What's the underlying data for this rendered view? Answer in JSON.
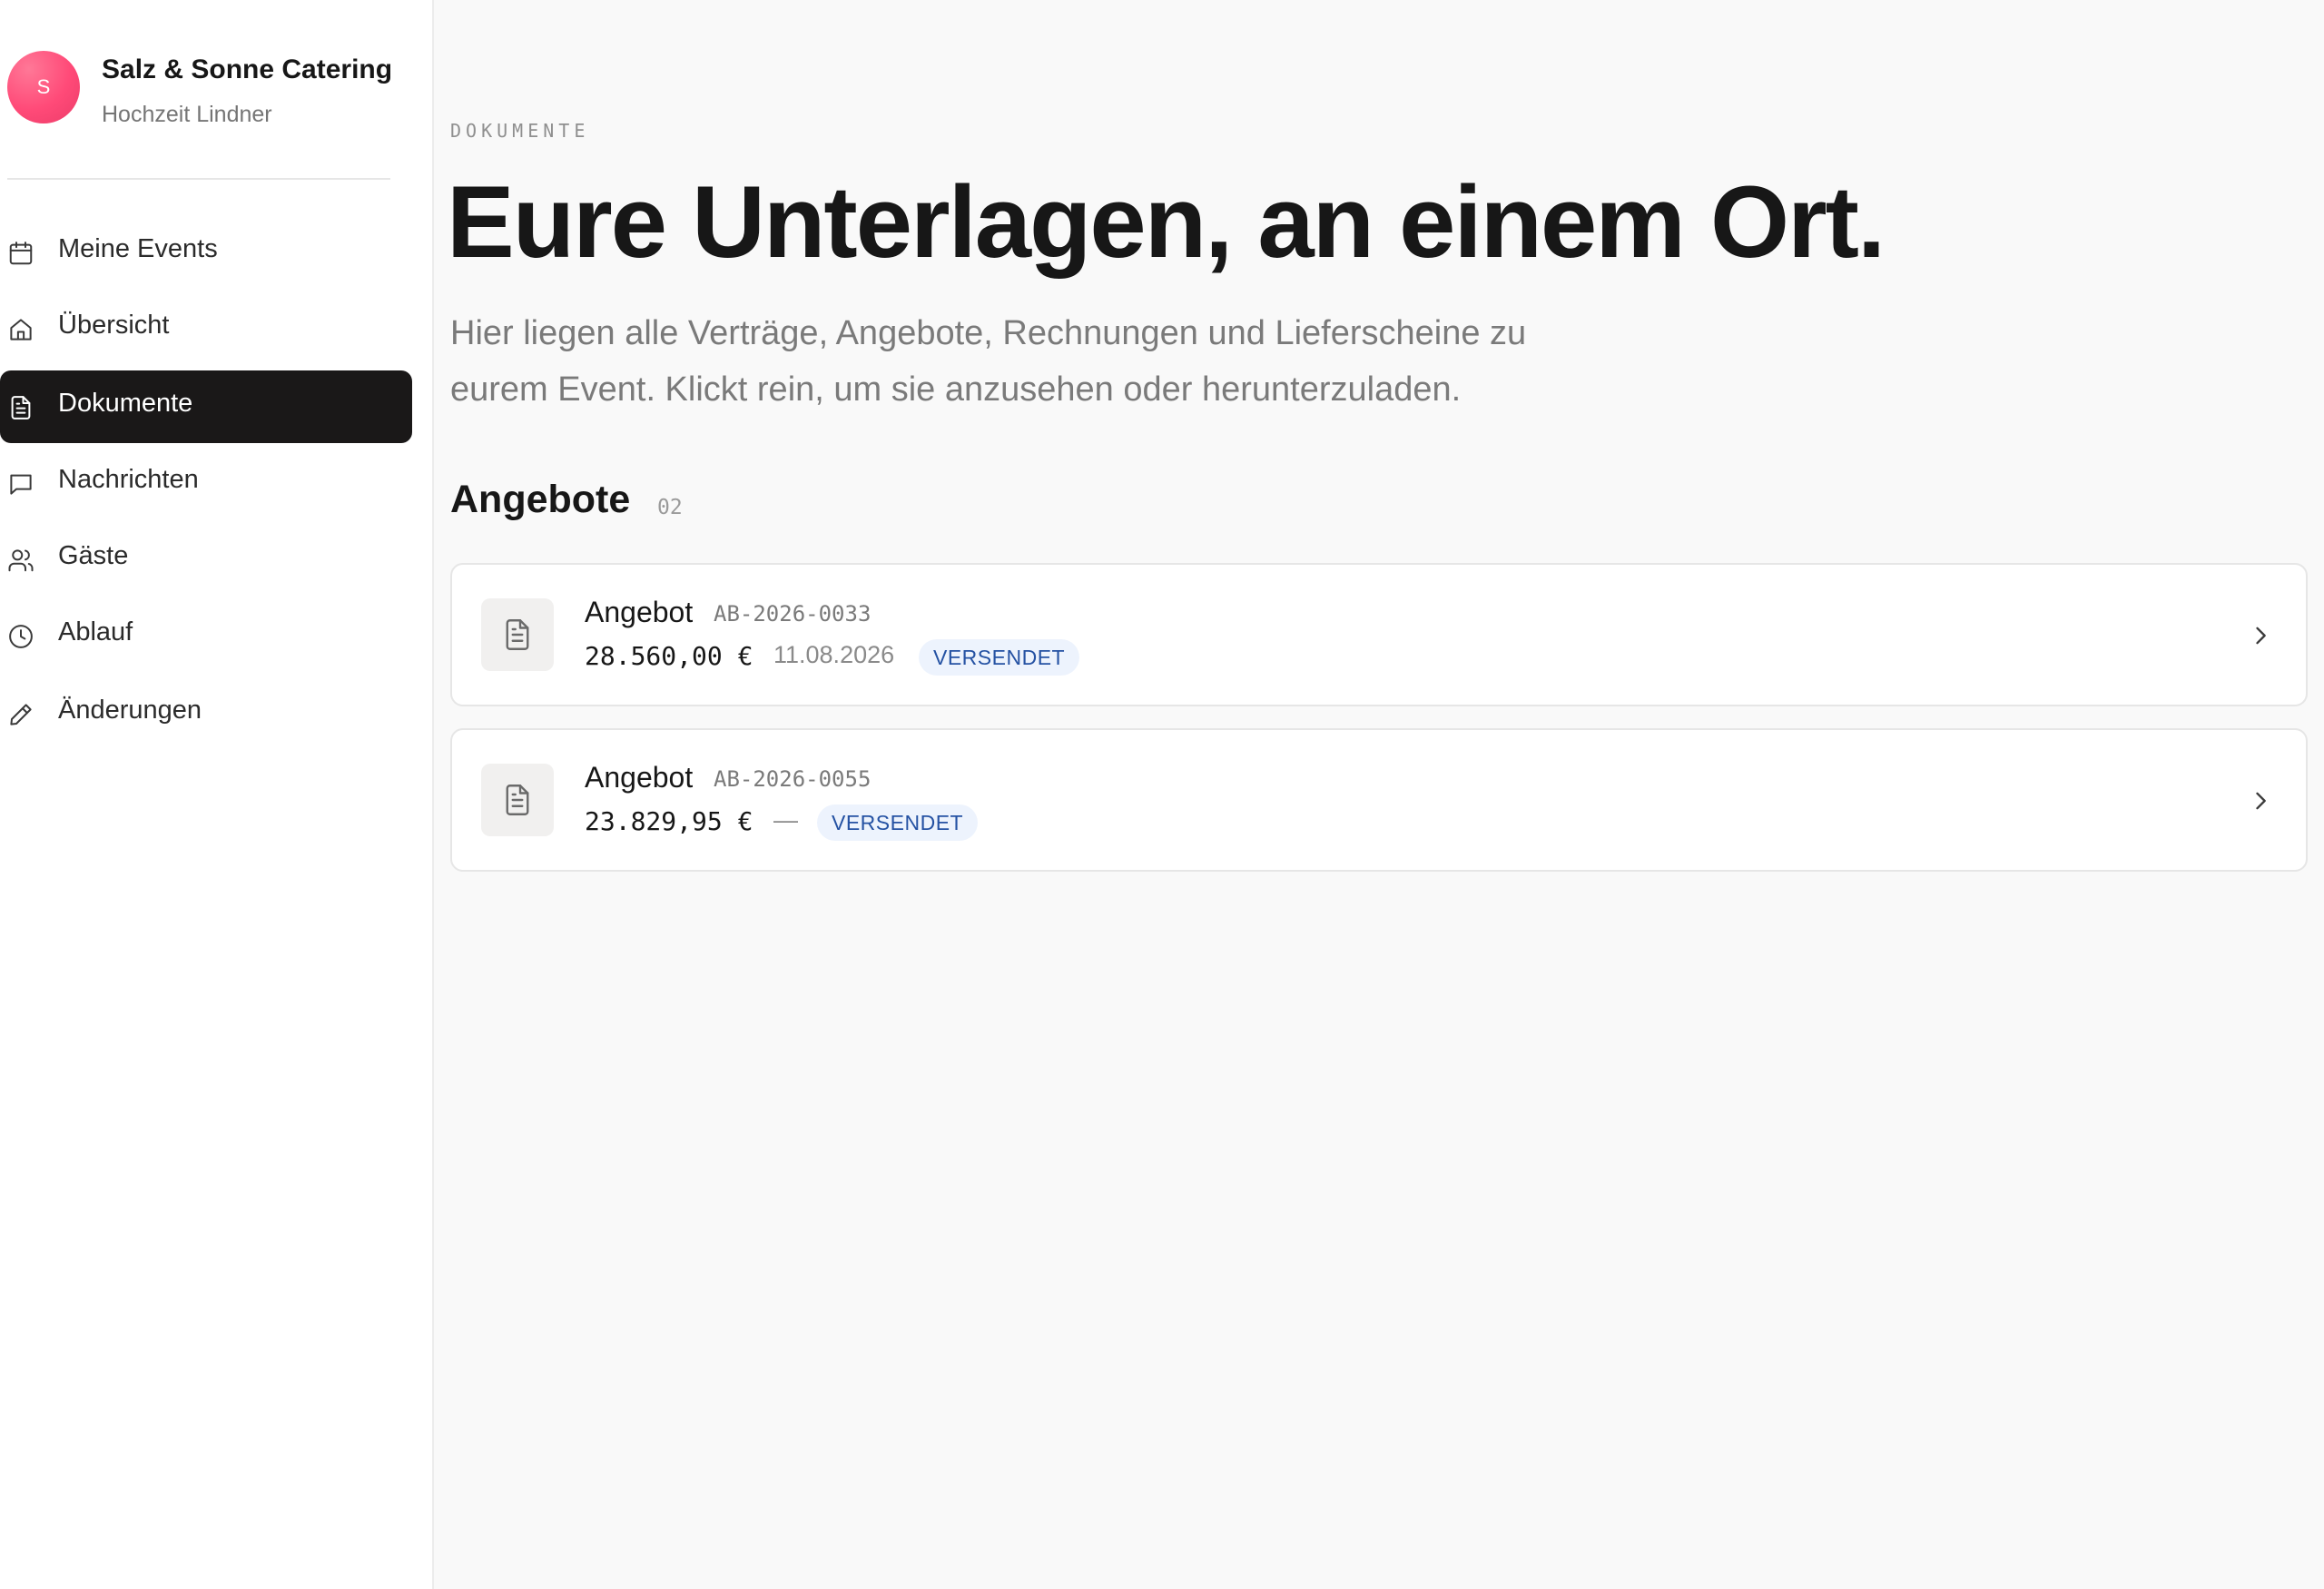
{
  "sidebar": {
    "brand": {
      "initial": "S",
      "name": "Salz & Sonne Catering",
      "event": "Hochzeit Lindner"
    },
    "items": [
      {
        "label": "Meine Events",
        "icon": "calendar-icon",
        "active": false
      },
      {
        "label": "Übersicht",
        "icon": "home-icon",
        "active": false
      },
      {
        "label": "Dokumente",
        "icon": "document-icon",
        "active": true
      },
      {
        "label": "Nachrichten",
        "icon": "message-icon",
        "active": false
      },
      {
        "label": "Gäste",
        "icon": "users-icon",
        "active": false
      },
      {
        "label": "Ablauf",
        "icon": "clock-icon",
        "active": false
      },
      {
        "label": "Änderungen",
        "icon": "pencil-icon",
        "active": false
      }
    ]
  },
  "main": {
    "eyebrow": "DOKUMENTE",
    "title": "Eure Unterlagen, an einem Ort.",
    "lead": "Hier liegen alle Verträge, Angebote, Rechnungen und Lieferscheine zu eurem Event. Klickt rein, um sie anzusehen oder herunterzuladen.",
    "section": {
      "title": "Angebote",
      "count": "02"
    },
    "documents": [
      {
        "title": "Angebot",
        "number": "AB-2026-0033",
        "amount": "28.560,00 €",
        "date": "11.08.2026",
        "status": "VERSENDET"
      },
      {
        "title": "Angebot",
        "number": "AB-2026-0055",
        "amount": "23.829,95 €",
        "date": "—",
        "status": "VERSENDET"
      }
    ]
  },
  "colors": {
    "accent_dark": "#1a1818",
    "badge_background": "#edf3fd",
    "badge_text": "#2552a3",
    "avatar": "#ff4a78"
  }
}
